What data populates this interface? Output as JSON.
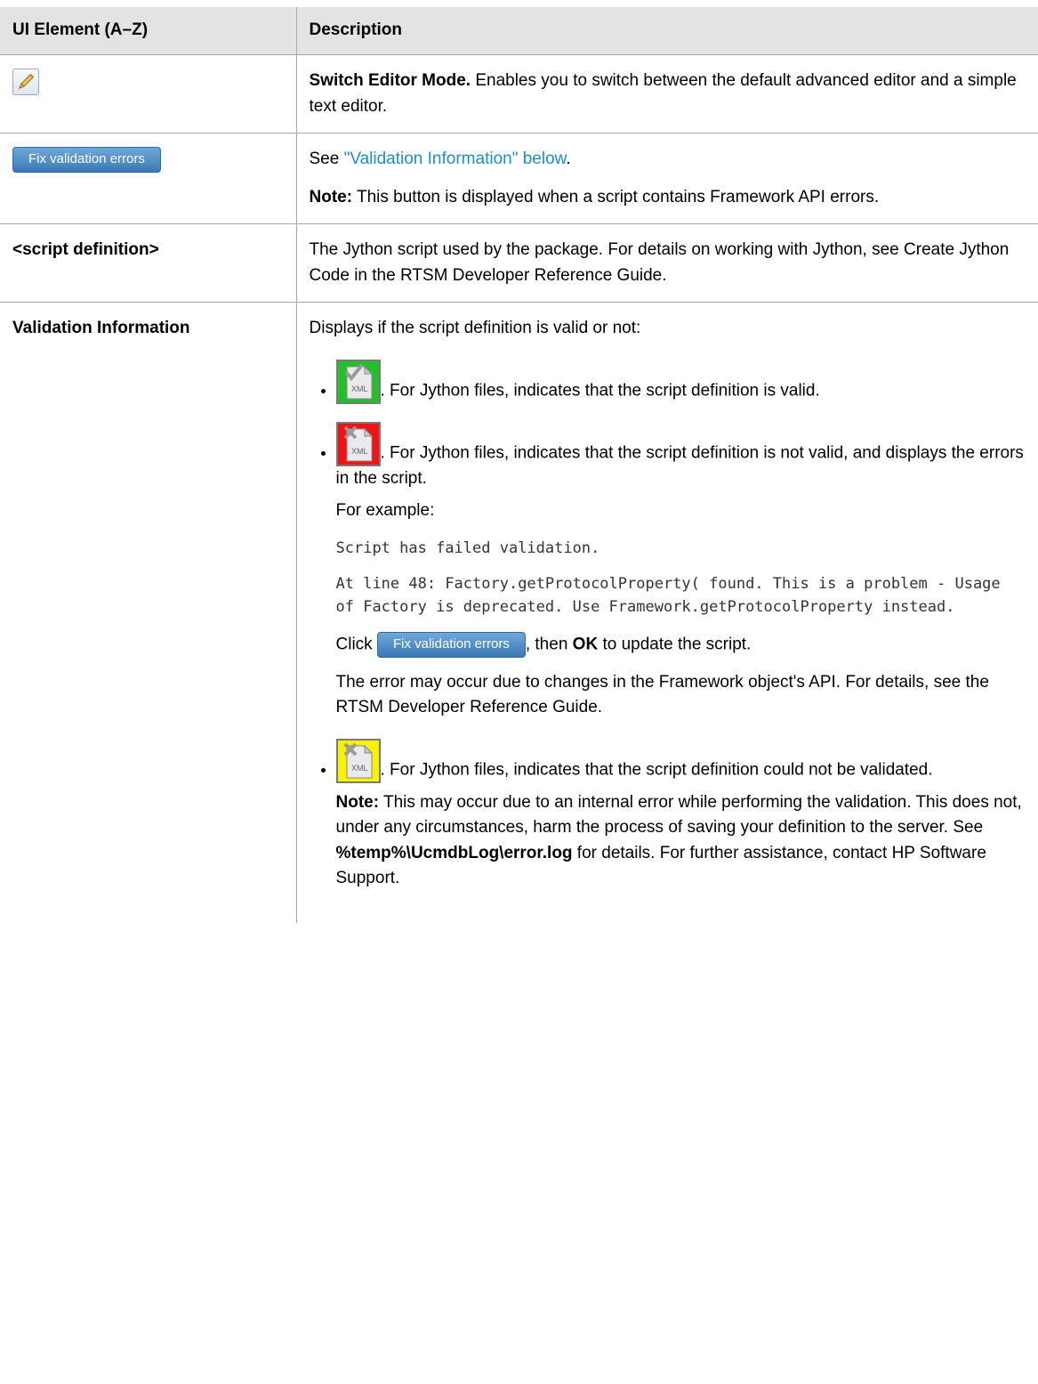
{
  "header": {
    "col1": "UI Element (A–Z)",
    "col2": "Description"
  },
  "row1": {
    "icon": "pencil-edit-icon",
    "title": "Switch Editor Mode.",
    "text": " Enables you to switch between the default advanced editor and a simple text editor."
  },
  "row2": {
    "button_label": "Fix validation errors",
    "see_prefix": "See ",
    "see_link": "\"Validation Information\" below",
    "see_suffix": ".",
    "note_label": "Note:",
    "note_text": " This button is displayed when a script contains Framework API errors."
  },
  "row3": {
    "element": "<script definition>",
    "text": "The Jython script used by the package. For details on working with Jython, see Create Jython Code in the RTSM Developer Reference Guide."
  },
  "row4": {
    "element": "Validation Information",
    "intro": "Displays if the script definition is valid or not:",
    "valid_text": ". For Jython files, indicates that the script definition is valid.",
    "invalid_text": ". For Jython files, indicates that the script definition is not valid, and displays the errors in the script.",
    "example_label": "For example:",
    "code_line1": "Script has failed validation.",
    "code_line2": "At line 48: Factory.getProtocolProperty( found. This is a problem - Usage of Factory is deprecated. Use Framework.getProtocolProperty instead.",
    "click_prefix": "Click ",
    "click_button": "Fix validation errors",
    "click_mid": ", then ",
    "click_ok": "OK",
    "click_suffix": " to update the script.",
    "error_text": "The error may occur due to changes in the Framework object's API. For details, see the RTSM Developer Reference Guide.",
    "unvalidated_text": ". For Jython files, indicates that the script definition could not be validated.",
    "note_label": "Note:",
    "note_text1": " This may occur due to an internal error while performing the validation. This does not, under any circumstances, harm the process of saving your definition to the server. See ",
    "note_path": "%temp%\\UcmdbLog\\error.log",
    "note_text2": " for details. For further assistance, contact HP Software Support.",
    "xml_label": "XML",
    "icon_colors": {
      "valid": "#22c12a",
      "invalid": "#f01313",
      "unvalidated": "#f7f300"
    }
  }
}
